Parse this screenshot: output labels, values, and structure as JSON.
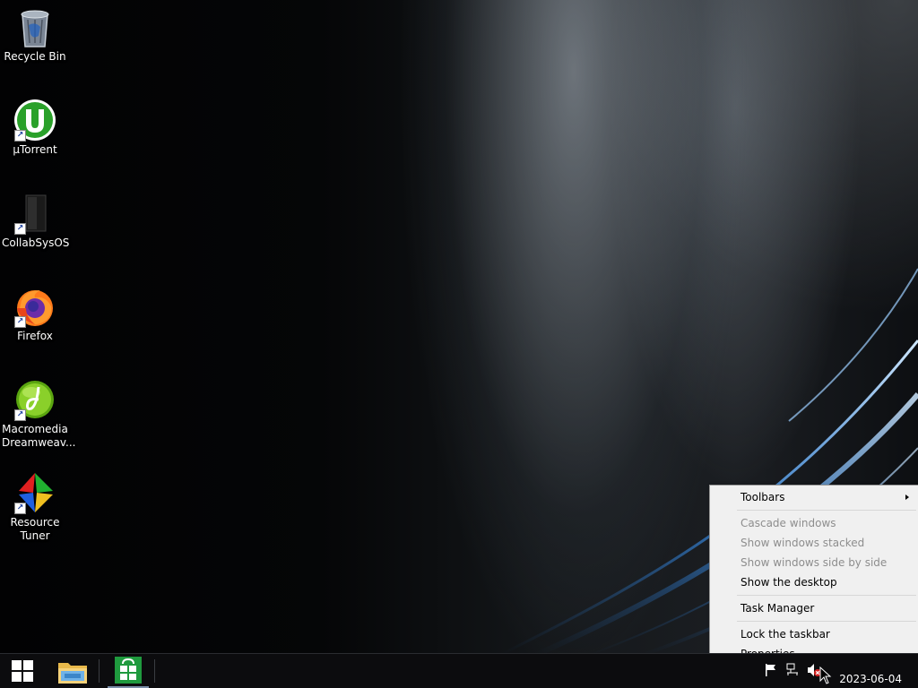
{
  "desktop": {
    "icons": [
      {
        "label": "Recycle Bin",
        "icon": "recycle-bin-icon"
      },
      {
        "label": "µTorrent",
        "icon": "utorrent-icon"
      },
      {
        "label": "CollabSysOS",
        "icon": "collabsysos-icon"
      },
      {
        "label": "Firefox",
        "icon": "firefox-icon"
      },
      {
        "label": "Macromedia Dreamweav...",
        "icon": "dreamweaver-icon"
      },
      {
        "label": "Resource Tuner",
        "icon": "resource-tuner-icon"
      }
    ]
  },
  "context_menu": {
    "items": [
      {
        "label": "Toolbars",
        "enabled": true,
        "submenu": true
      },
      {
        "label": "Cascade windows",
        "enabled": false
      },
      {
        "label": "Show windows stacked",
        "enabled": false
      },
      {
        "label": "Show windows side by side",
        "enabled": false
      },
      {
        "label": "Show the desktop",
        "enabled": true
      },
      {
        "label": "Task Manager",
        "enabled": true
      },
      {
        "label": "Lock the taskbar",
        "enabled": true
      },
      {
        "label": "Properties",
        "enabled": true
      }
    ]
  },
  "taskbar": {
    "pinned": [
      "start-icon",
      "file-explorer-icon",
      "store-icon"
    ],
    "tray": {
      "icons": [
        "action-center-flag-icon",
        "network-icon",
        "volume-muted-icon"
      ],
      "date": "2023-06-04"
    }
  },
  "colors": {
    "menu_bg": "#f0f0f0",
    "menu_disabled_text": "#8d8d8d",
    "taskbar_bg": "#0c0c0e",
    "swoosh_blue": "#4fa8ff"
  }
}
